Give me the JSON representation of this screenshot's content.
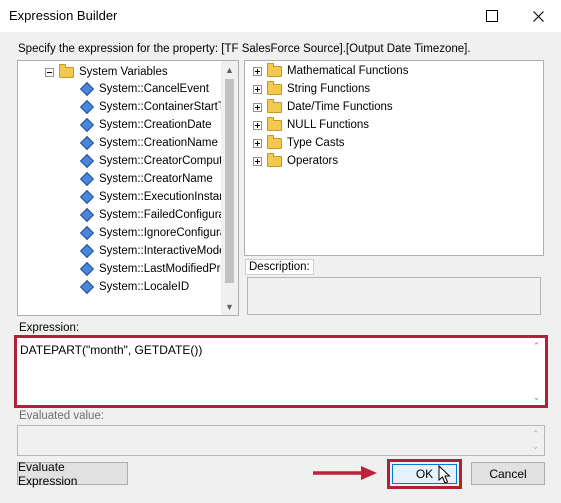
{
  "window": {
    "title": "Expression Builder"
  },
  "prompt": "Specify the expression for the property: [TF SalesForce Source].[Output Date Timezone].",
  "variables_tree": {
    "root_label": "System Variables",
    "items": [
      "System::CancelEvent",
      "System::ContainerStartTim",
      "System::CreationDate",
      "System::CreationName",
      "System::CreatorComputerN",
      "System::CreatorName",
      "System::ExecutionInstanc",
      "System::FailedConfiguratic",
      "System::IgnoreConfiguratic",
      "System::InteractiveMode",
      "System::LastModifiedProd",
      "System::LocaleID"
    ]
  },
  "functions_tree": {
    "items": [
      "Mathematical Functions",
      "String Functions",
      "Date/Time Functions",
      "NULL Functions",
      "Type Casts",
      "Operators"
    ]
  },
  "description": {
    "label": "Description:"
  },
  "expression": {
    "label": "Expression:",
    "value": "DATEPART(\"month\", GETDATE())"
  },
  "evaluated": {
    "label": "Evaluated value:"
  },
  "buttons": {
    "evaluate": "Evaluate Expression",
    "ok": "OK",
    "cancel": "Cancel"
  },
  "colors": {
    "highlight": "#b0203a",
    "accent_arrow": "#c0213a"
  },
  "icons": [
    "close-icon",
    "maximize-icon",
    "folder-icon",
    "variable-icon",
    "mouse-cursor-icon"
  ]
}
